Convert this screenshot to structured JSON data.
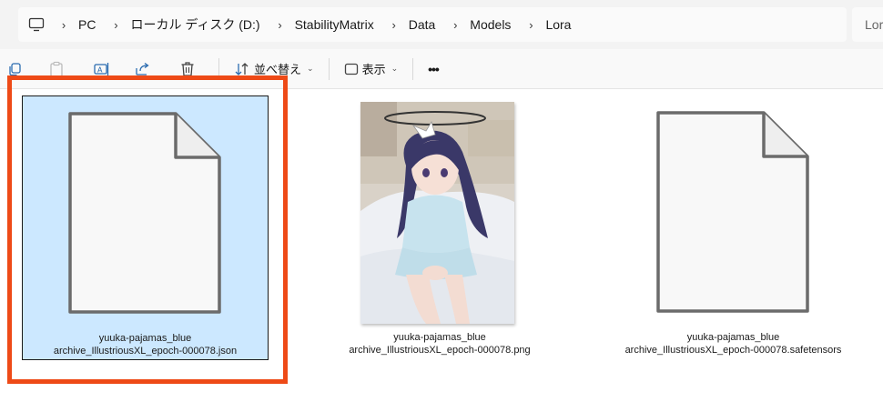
{
  "breadcrumb": {
    "items": [
      "PC",
      "ローカル ディスク (D:)",
      "StabilityMatrix",
      "Data",
      "Models",
      "Lora"
    ]
  },
  "search": {
    "placeholder": "Lora"
  },
  "toolbar": {
    "sort_label": "並べ替え",
    "view_label": "表示",
    "more_label": "•••"
  },
  "files": [
    {
      "line1": "yuuka-pajamas_blue",
      "line2": "archive_IllustriousXL_epoch-000078.json",
      "type": "generic-file-icon",
      "selected": true
    },
    {
      "line1": "yuuka-pajamas_blue",
      "line2": "archive_IllustriousXL_epoch-000078.png",
      "type": "image-thumbnail",
      "selected": false
    },
    {
      "line1": "yuuka-pajamas_blue",
      "line2": "archive_IllustriousXL_epoch-000078.safetensors",
      "type": "generic-file-icon",
      "selected": false
    }
  ],
  "colors": {
    "selection_bg": "#cce8ff",
    "annotation_border": "#ee4a17",
    "address_bg": "#f3f3f3"
  }
}
